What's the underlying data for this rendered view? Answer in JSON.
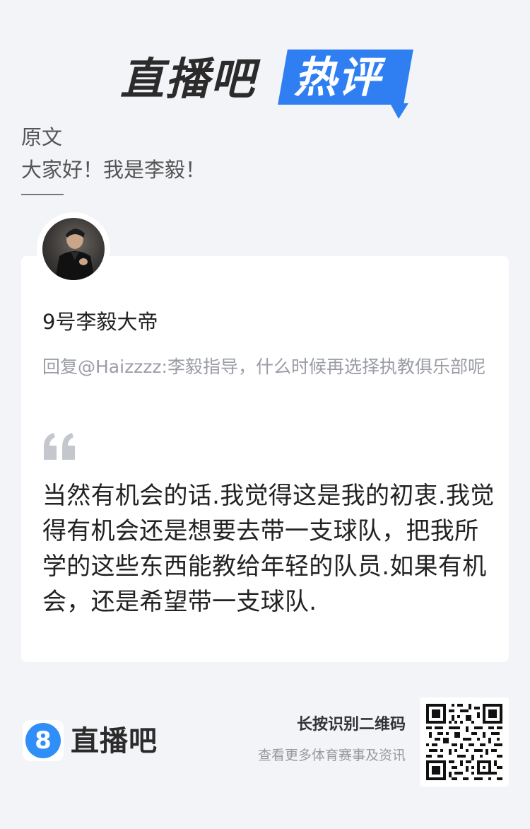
{
  "header": {
    "logo_left": "直播吧",
    "logo_right": "热评"
  },
  "original": {
    "label": "原文",
    "text": "大家好！我是李毅！"
  },
  "comment": {
    "username": "9号李毅大帝",
    "reply": "回复@Haizzzz:李毅指导，什么时候再选择执教俱乐部呢",
    "body": "当然有机会的话.我觉得这是我的初衷.我觉得有机会还是想要去带一支球队，把我所学的这些东西能教给年轻的队员.如果有机会，还是希望带一支球队."
  },
  "footer": {
    "badge": "8",
    "brand": "直播吧",
    "qr_title": "长按识别二维码",
    "qr_subtitle": "查看更多体育赛事及资讯"
  },
  "colors": {
    "accent": "#2f7ff3",
    "background": "#f3f4f8",
    "muted": "#9a9da5"
  }
}
